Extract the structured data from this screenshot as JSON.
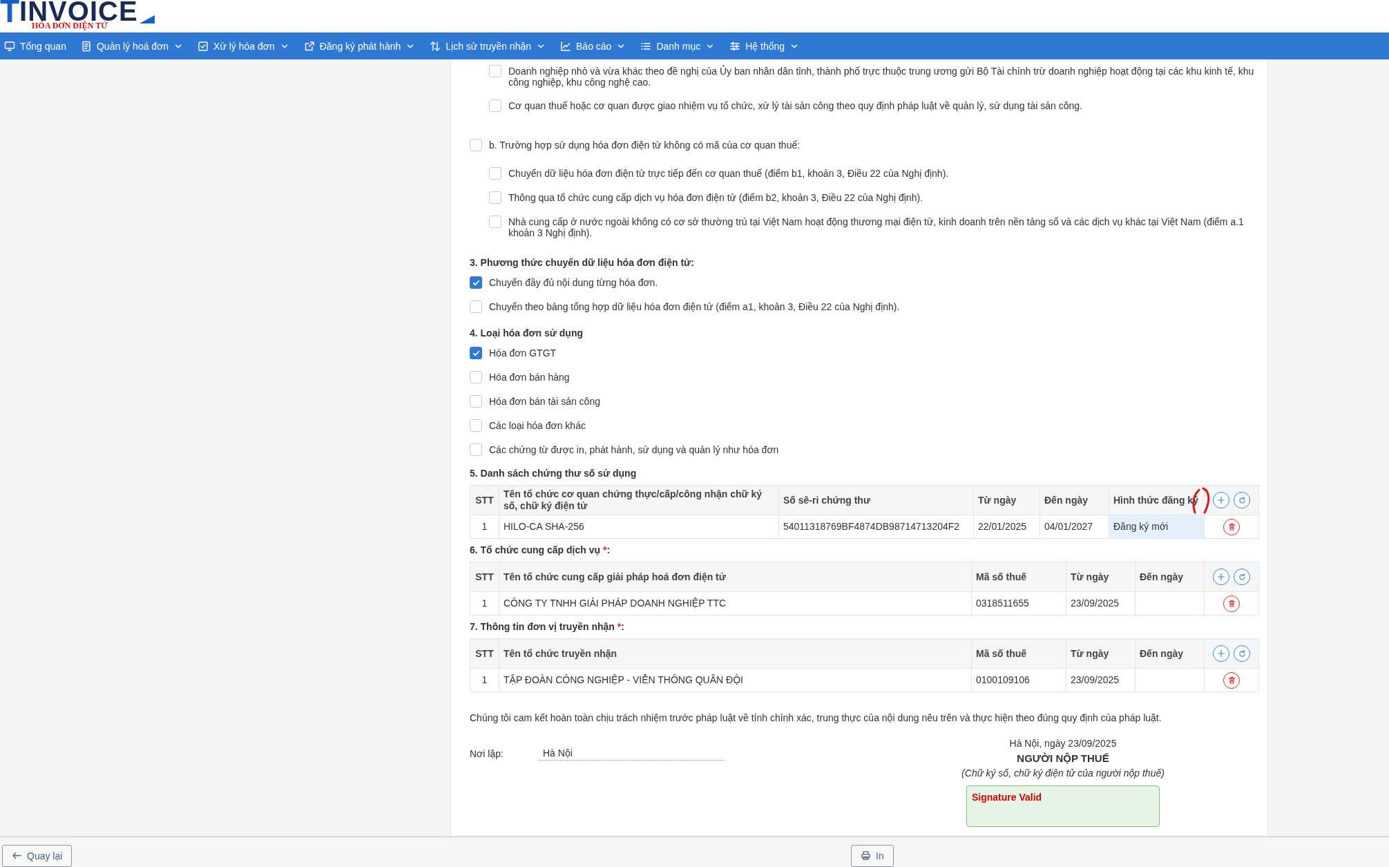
{
  "logo": {
    "mark": "T",
    "name": "INVOICE",
    "tagline": "HÓA ĐƠN ĐIỆN TỬ"
  },
  "nav": [
    {
      "label": "Tổng quan",
      "dropdown": false
    },
    {
      "label": "Quản lý hoá đơn",
      "dropdown": true
    },
    {
      "label": "Xử lý hóa đơn",
      "dropdown": true
    },
    {
      "label": "Đăng ký phát hành",
      "dropdown": true
    },
    {
      "label": "Lịch sử truyền nhận",
      "dropdown": true
    },
    {
      "label": "Báo cáo",
      "dropdown": true
    },
    {
      "label": "Danh mục",
      "dropdown": true
    },
    {
      "label": "Hệ thống",
      "dropdown": true
    }
  ],
  "scope": {
    "continued_items": [
      {
        "label": "Doanh nghiệp nhỏ và vừa khác theo đề nghị của Ủy ban nhân dân tỉnh, thành phố trực thuộc trung ương gửi Bộ Tài chính trừ doanh nghiệp hoạt động tại các khu kinh tế, khu công nghiệp, khu công nghệ cao.",
        "checked": false
      },
      {
        "label": "Cơ quan thuế hoặc cơ quan được giao nhiệm vụ tổ chức, xử lý tài sản công theo quy định pháp luật về quản lý, sử dụng tài sản công.",
        "checked": false
      }
    ],
    "groups": [
      {
        "label": "b. Trường hợp sử dụng hóa đơn điện tử không có mã của cơ quan thuế:",
        "checked": false,
        "children": [
          {
            "label": "Chuyển dữ liệu hóa đơn điện tử trực tiếp đến cơ quan thuế (điểm b1, khoản 3, Điều 22 của Nghị định).",
            "checked": false
          },
          {
            "label": "Thông qua tổ chức cung cấp dịch vụ hóa đơn điện tử (điểm b2, khoản 3, Điều 22 của Nghị định).",
            "checked": false
          },
          {
            "label": "Nhà cung cấp ở nước ngoài không có cơ sở thường trú tại Việt Nam hoạt động thương mại điện tử, kinh doanh trên nền tảng số và các dịch vụ khác tại Việt Nam (điểm a.1 khoản 3 Nghị định).",
            "checked": false
          }
        ]
      }
    ]
  },
  "sections": [
    {
      "kind": "options",
      "title": "3. Phương thức chuyển dữ liệu hóa đơn điện tử:",
      "options": [
        {
          "label": "Chuyển đầy đủ nội dung từng hóa đơn.",
          "checked": true
        },
        {
          "label": "Chuyển theo bảng tổng hợp dữ liệu hóa đơn điện tử (điểm a1, khoản 3, Điều 22 của Nghị định).",
          "checked": false
        }
      ]
    },
    {
      "kind": "options",
      "title": "4. Loại hóa đơn sử dụng",
      "options": [
        {
          "label": "Hóa đơn GTGT",
          "checked": true
        },
        {
          "label": "Hóa đơn bán hàng",
          "checked": false
        },
        {
          "label": "Hóa đơn bán tài sản công",
          "checked": false
        },
        {
          "label": "Các loại hóa đơn khác",
          "checked": false
        },
        {
          "label": "Các chứng từ được in, phát hành, sử dụng và quản lý như hóa đơn",
          "checked": false
        }
      ]
    },
    {
      "kind": "table",
      "title": "5. Danh sách chứng thư số sử dụng",
      "table": {
        "columns": [
          {
            "label": "STT",
            "kind": "index"
          },
          {
            "label": "Tên tổ chức cơ quan chứng thực/cấp/công nhận chữ ký số, chữ ký điện tử",
            "kind": "text"
          },
          {
            "label": "Số sê-ri chứng thư",
            "kind": "text"
          },
          {
            "label": "Từ ngày",
            "kind": "text"
          },
          {
            "label": "Đến ngày",
            "kind": "text"
          },
          {
            "label": "Hình thức đăng ký",
            "kind": "field"
          }
        ],
        "rows": [
          [
            "1",
            "HILO-CA SHA-256",
            "54011318769BF4874DB98714713204F2",
            "22/01/2025",
            "04/01/2027",
            "Đăng ký mới"
          ]
        ]
      }
    },
    {
      "kind": "table",
      "title": "6. Tổ chức cung cấp dịch vụ ",
      "required_mark": "*",
      "suffix": ":",
      "table": {
        "columns": [
          {
            "label": "STT",
            "kind": "index"
          },
          {
            "label": "Tên tổ chức cung cấp giải pháp hoá đơn điện tử",
            "kind": "text"
          },
          {
            "label": "Mã số thuế",
            "kind": "text"
          },
          {
            "label": "Từ ngày",
            "kind": "text"
          },
          {
            "label": "Đến ngày",
            "kind": "text"
          }
        ],
        "rows": [
          [
            "1",
            "CÔNG TY TNHH GIẢI PHÁP DOANH NGHIỆP TTC",
            "0318511655",
            "23/09/2025",
            null
          ]
        ]
      }
    },
    {
      "kind": "table",
      "title": "7. Thông tin đơn vị truyền nhận ",
      "required_mark": "*",
      "suffix": ":",
      "table": {
        "columns": [
          {
            "label": "STT",
            "kind": "index"
          },
          {
            "label": "Tên tổ chức truyền nhận",
            "kind": "text"
          },
          {
            "label": "Mã số thuế",
            "kind": "text"
          },
          {
            "label": "Từ ngày",
            "kind": "text"
          },
          {
            "label": "Đến ngày",
            "kind": "text"
          }
        ],
        "rows": [
          [
            "1",
            "TẬP ĐOÀN CÔNG NGHIỆP - VIỄN THÔNG QUÂN ĐỘI",
            "0100109106",
            "23/09/2025",
            null
          ]
        ]
      }
    }
  ],
  "statement": "Chúng tôi cam kết hoàn toàn chịu trách nhiệm trước pháp luật về tính chính xác, trung thực của nội dung nêu trên và thực hiện theo đúng quy định của pháp luật.",
  "place": {
    "label": "Nơi lập:",
    "value": "Hà Nội"
  },
  "signer": {
    "date_line": "Hà Nội, ngày 23/09/2025",
    "title": "NGƯỜI NỘP THUẾ",
    "note": "(Chữ ký số, chữ ký điện tử của người nộp thuế)",
    "signature_status": "Signature Valid"
  },
  "footer": {
    "back": "Quay lại",
    "print": "In"
  }
}
